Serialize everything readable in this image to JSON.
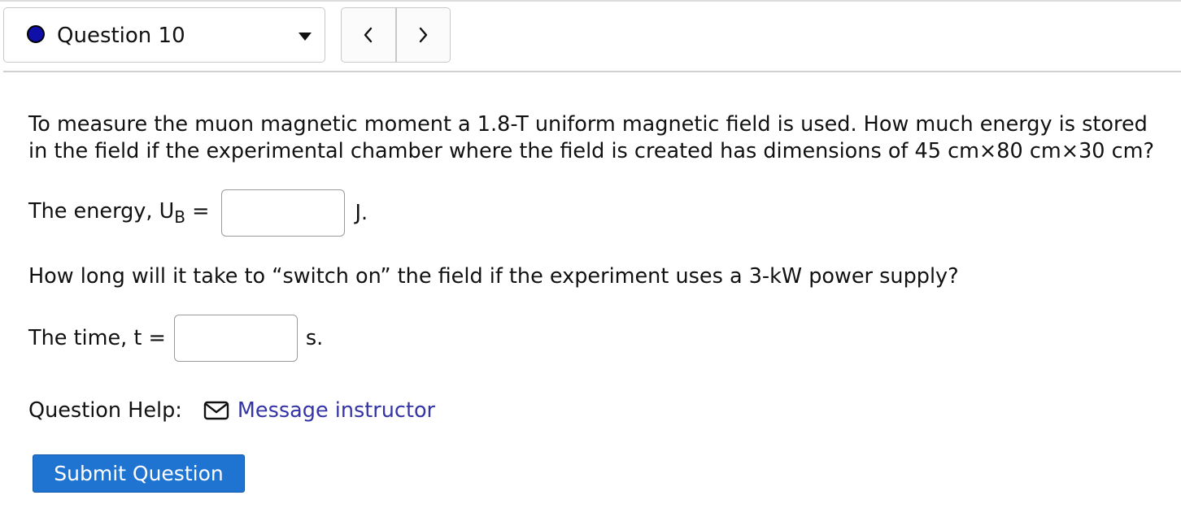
{
  "header": {
    "question_selector": {
      "label": "Question 10",
      "status_color": "#1010a8"
    },
    "nav": {
      "prev_icon": "chevron-left-icon",
      "next_icon": "chevron-right-icon"
    }
  },
  "question": {
    "text": "To measure the muon magnetic moment a 1.8-T uniform magnetic field is used. How much energy is stored in the field if the experimental chamber where the field is created has dimensions of 45 cm×80 cm×30 cm?",
    "part1": {
      "label_prefix": "The energy, U",
      "label_sub": "B",
      "label_suffix": " =",
      "value": "",
      "unit": "J."
    },
    "part2_text": "How long will it take to “switch on” the field if the experiment uses a 3-kW power supply?",
    "part2": {
      "label": "The time, t =",
      "value": "",
      "unit": "s."
    }
  },
  "help": {
    "label": "Question Help:",
    "icon": "envelope-icon",
    "link_text": "Message instructor"
  },
  "submit": {
    "label": "Submit Question",
    "color": "#1f74d1"
  }
}
